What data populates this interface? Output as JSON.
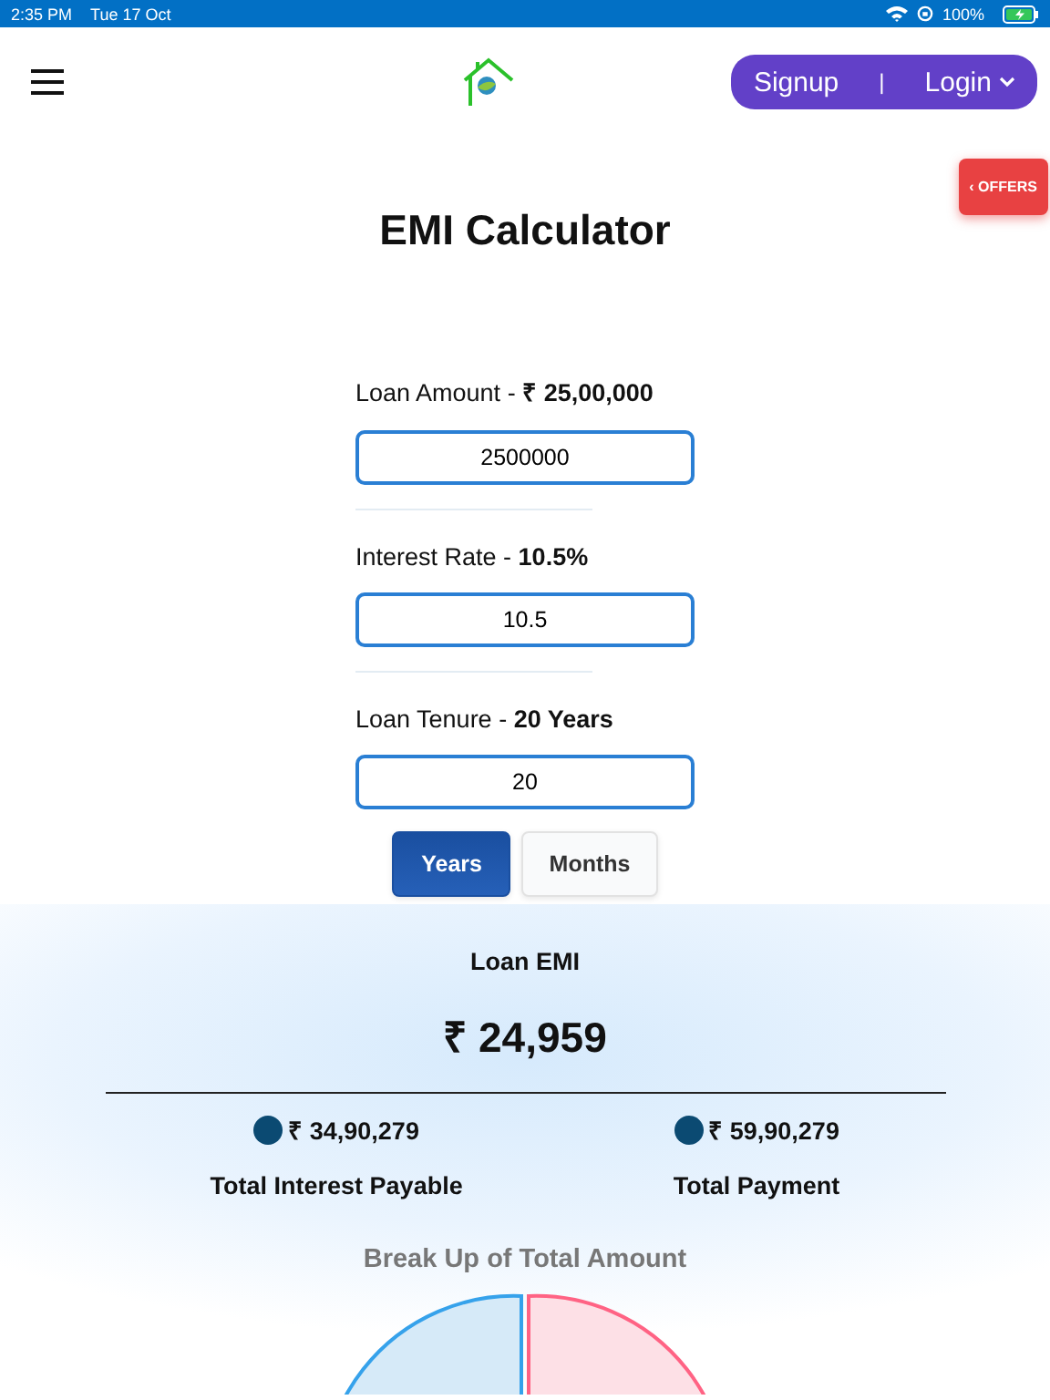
{
  "status_bar": {
    "time": "2:35 PM",
    "date": "Tue 17 Oct",
    "battery": "100%"
  },
  "header": {
    "signup": "Signup",
    "separator": "|",
    "login": "Login"
  },
  "offers": {
    "label": "OFFERS",
    "arrow": "‹"
  },
  "title": "EMI Calculator",
  "fields": [
    {
      "label": "Loan Amount - **₹ 25,00,000**",
      "value": "2500000"
    },
    {
      "label": "Interest Rate - **10.5%**",
      "value": "10.5"
    },
    {
      "label": "Loan Tenure - **20 Years**",
      "value": "20"
    }
  ],
  "tenure_units": [
    {
      "label": "Years",
      "selected": true
    },
    {
      "label": "Months",
      "selected": false
    }
  ],
  "result": {
    "label": "Loan EMI",
    "amount": "₹ 24,959"
  },
  "totals": [
    {
      "amount": "₹ 34,90,279",
      "label": "Total Interest Payable",
      "color": "#0b4a72"
    },
    {
      "amount": "₹ 59,90,279",
      "label": "Total Payment",
      "color": "#0b4a72"
    }
  ],
  "chart_title": "Break Up of Total Amount"
}
